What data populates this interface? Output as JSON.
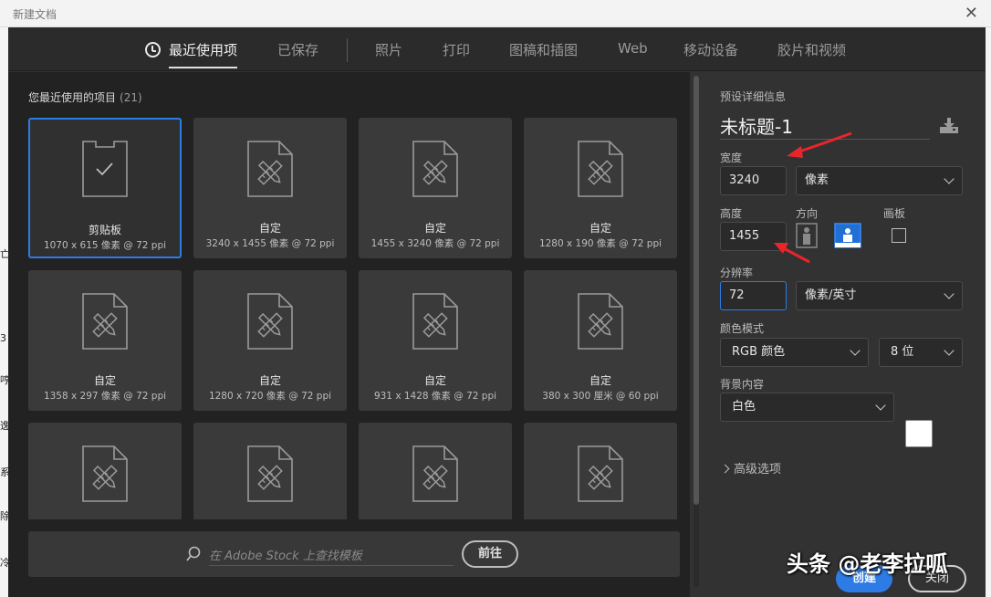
{
  "window": {
    "title": "新建文档",
    "close_glyph": "✕"
  },
  "left_strip": [
    "亡",
    "3",
    "哼",
    "逸",
    "系",
    "除",
    "冷"
  ],
  "tabs": [
    {
      "label": "最近使用项",
      "active": true,
      "icon": "clock-icon"
    },
    {
      "label": "已保存"
    },
    {
      "label": "照片"
    },
    {
      "label": "打印"
    },
    {
      "label": "图稿和插图"
    },
    {
      "label": "Web"
    },
    {
      "label": "移动设备"
    },
    {
      "label": "胶片和视频"
    }
  ],
  "recent": {
    "heading": "您最近使用的项目",
    "count": "(21)",
    "items": [
      {
        "name": "剪贴板",
        "sub": "1070 x 615 像素 @ 72 ppi",
        "icon": "clipboard-icon",
        "selected": true
      },
      {
        "name": "自定",
        "sub": "3240 x 1455 像素 @ 72 ppi",
        "icon": "custom-document-icon"
      },
      {
        "name": "自定",
        "sub": "1455 x 3240 像素 @ 72 ppi",
        "icon": "custom-document-icon"
      },
      {
        "name": "自定",
        "sub": "1280 x 190 像素 @ 72 ppi",
        "icon": "custom-document-icon"
      },
      {
        "name": "自定",
        "sub": "1358 x 297 像素 @ 72 ppi",
        "icon": "custom-document-icon"
      },
      {
        "name": "自定",
        "sub": "1280 x 720 像素 @ 72 ppi",
        "icon": "custom-document-icon"
      },
      {
        "name": "自定",
        "sub": "931 x 1428 像素 @ 72 ppi",
        "icon": "custom-document-icon"
      },
      {
        "name": "自定",
        "sub": "380 x 300 厘米 @ 60 ppi",
        "icon": "custom-document-icon"
      },
      {
        "name": "",
        "sub": "",
        "icon": "custom-document-icon"
      },
      {
        "name": "",
        "sub": "",
        "icon": "custom-document-icon"
      },
      {
        "name": "",
        "sub": "",
        "icon": "custom-document-icon"
      },
      {
        "name": "",
        "sub": "",
        "icon": "custom-document-icon"
      }
    ]
  },
  "stock_search": {
    "placeholder": "在 Adobe Stock 上查找模板",
    "go_label": "前往"
  },
  "details": {
    "heading": "预设详细信息",
    "doc_name": "未标题-1",
    "width_label": "宽度",
    "width_value": "3240",
    "width_unit": "像素",
    "height_label": "高度",
    "height_value": "1455",
    "orientation_label": "方向",
    "artboard_label": "画板",
    "resolution_label": "分辨率",
    "resolution_value": "72",
    "resolution_unit": "像素/英寸",
    "color_mode_label": "颜色模式",
    "color_mode_value": "RGB 颜色",
    "bit_depth_value": "8 位",
    "background_label": "背景内容",
    "background_value": "白色",
    "advanced_label": "高级选项",
    "create_label": "创建",
    "close_label": "关闭"
  },
  "watermark": "头条 @老李拉呱",
  "colors": {
    "accent": "#2d7be5",
    "annotation_arrow": "#e8252a"
  }
}
